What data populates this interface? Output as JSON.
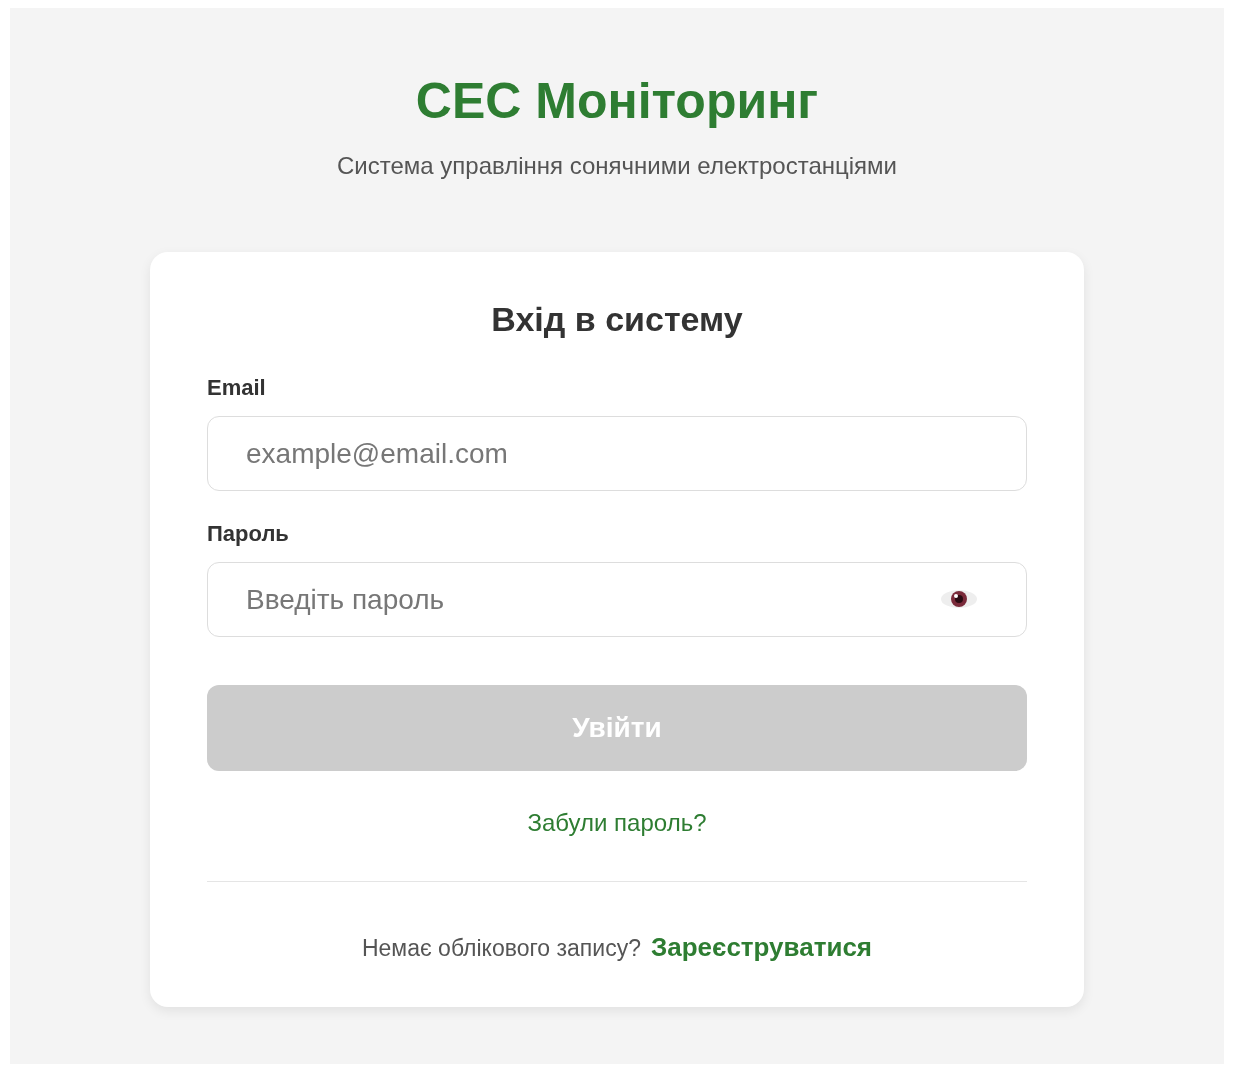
{
  "header": {
    "title": "СЕС Моніторинг",
    "subtitle": "Система управління сонячними електростанціями"
  },
  "card": {
    "title": "Вхід в систему",
    "fields": [
      {
        "kind": "text",
        "label": "Email",
        "placeholder": "example@email.com"
      },
      {
        "kind": "password",
        "label": "Пароль",
        "placeholder": "Введіть пароль"
      }
    ],
    "submit": {
      "label": "Увійти",
      "disabled": true
    },
    "forgot_link": "Забули пароль?",
    "footer": {
      "text": "Немає облікового запису?",
      "link": "Зареєструватися"
    }
  }
}
